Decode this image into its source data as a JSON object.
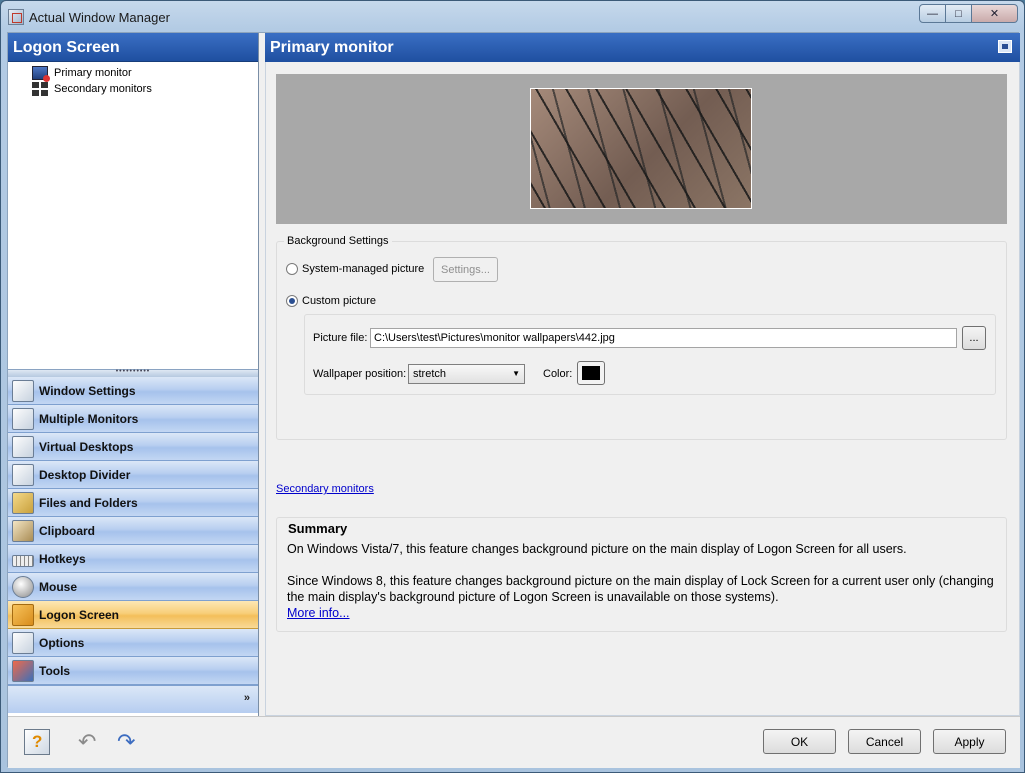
{
  "window": {
    "title": "Actual Window Manager",
    "minimize": "—",
    "maximize": "□",
    "close": "✕"
  },
  "left_pane": {
    "header": "Logon Screen",
    "tree": [
      {
        "label": "Primary monitor",
        "icon": "monitor-icon"
      },
      {
        "label": "Secondary monitors",
        "icon": "multi-monitor-icon"
      }
    ],
    "splitter": "••••••••••",
    "nav": [
      {
        "label": "Window Settings",
        "icon": "window-settings-icon"
      },
      {
        "label": "Multiple Monitors",
        "icon": "multiple-monitors-icon"
      },
      {
        "label": "Virtual Desktops",
        "icon": "virtual-desktops-icon"
      },
      {
        "label": "Desktop Divider",
        "icon": "desktop-divider-icon"
      },
      {
        "label": "Files and Folders",
        "icon": "folder-icon"
      },
      {
        "label": "Clipboard",
        "icon": "clipboard-icon"
      },
      {
        "label": "Hotkeys",
        "icon": "keyboard-icon"
      },
      {
        "label": "Mouse",
        "icon": "mouse-icon"
      },
      {
        "label": "Logon Screen",
        "icon": "key-icon",
        "active": true
      },
      {
        "label": "Options",
        "icon": "options-icon"
      },
      {
        "label": "Tools",
        "icon": "tools-icon"
      }
    ],
    "footer_chevron": "»"
  },
  "right_pane": {
    "header": "Primary monitor",
    "background_settings": {
      "legend": "Background Settings",
      "system_managed_label": "System-managed picture",
      "settings_button": "Settings...",
      "custom_label": "Custom picture",
      "selected": "custom",
      "picture_file_label": "Picture file:",
      "picture_file_value": "C:\\Users\\test\\Pictures\\monitor wallpapers\\442.jpg",
      "browse_button": "...",
      "position_label": "Wallpaper position:",
      "position_value": "stretch",
      "color_label": "Color:",
      "color_value": "#000000"
    },
    "secondary_link": "Secondary monitors",
    "summary": {
      "title": "Summary",
      "para1": "On Windows Vista/7, this feature changes background picture on the main display of Logon Screen for all users.",
      "para2": "Since Windows 8, this feature changes background picture on the main display of Lock Screen for a current user only (changing the main display's background picture of Logon Screen is unavailable on those systems).",
      "more_link": "More info..."
    }
  },
  "bottom_bar": {
    "ok": "OK",
    "cancel": "Cancel",
    "apply": "Apply"
  }
}
